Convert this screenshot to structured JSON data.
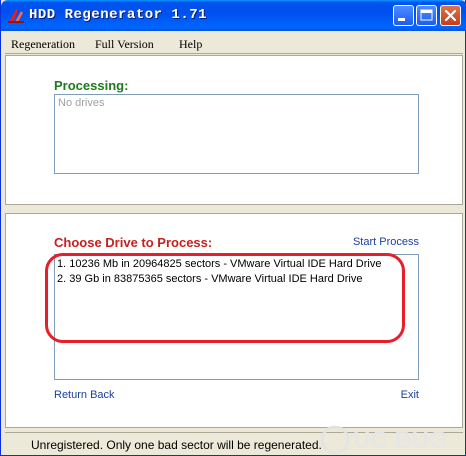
{
  "window": {
    "title": "HDD Regenerator 1.71",
    "colors": {
      "titlebar": "#0055ee",
      "processing_heading": "#1e7a1e",
      "choose_heading": "#c8201e",
      "link": "#1a3fa0",
      "annotation": "#e81f2b"
    }
  },
  "menu": {
    "items": [
      "Regeneration",
      "Full Version",
      "Help"
    ]
  },
  "processing": {
    "heading": "Processing:",
    "placeholder": "No drives"
  },
  "choose": {
    "heading": "Choose Drive to Process:",
    "start_label": "Start Process",
    "drives": [
      "1. 10236 Mb in 20964825 sectors  -  VMware Virtual IDE Hard Drive",
      "2. 39 Gb in 83875365 sectors  -  VMware Virtual IDE Hard Drive"
    ],
    "return_label": "Return Back",
    "exit_label": "Exit"
  },
  "status": {
    "text": "Unregistered. Only one bad sector will be regenerated."
  },
  "watermark": {
    "text": "UC BUG"
  }
}
